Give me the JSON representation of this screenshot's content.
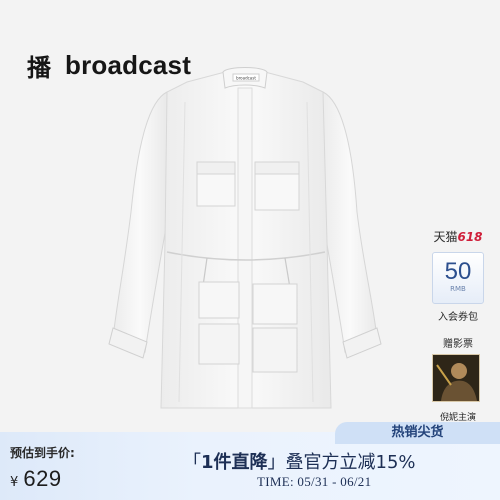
{
  "brand": {
    "chinese": "播",
    "english": "broadcast"
  },
  "product": {
    "label_text": "broadcast"
  },
  "side": {
    "tmall_prefix": "天猫",
    "tmall_number": "618",
    "coupon_value": "50",
    "coupon_unit": "RMB",
    "coupon_label": "入会券包",
    "ticket_label": "赠影票",
    "lead_label": "倪妮主演"
  },
  "bottom": {
    "hot_label": "热销尖货",
    "estimate_label": "预估到手价:",
    "currency": "¥",
    "price": "629",
    "promo_open": "「",
    "promo_highlight": "1件直降",
    "promo_close": "」",
    "promo_rest": "叠官方立减15%",
    "time_text": "TIME: 05/31 - 06/21"
  },
  "colors": {
    "bar": "#dde9f9",
    "accent_blue": "#2c4f8e",
    "tmall_red": "#cf1f3a"
  }
}
